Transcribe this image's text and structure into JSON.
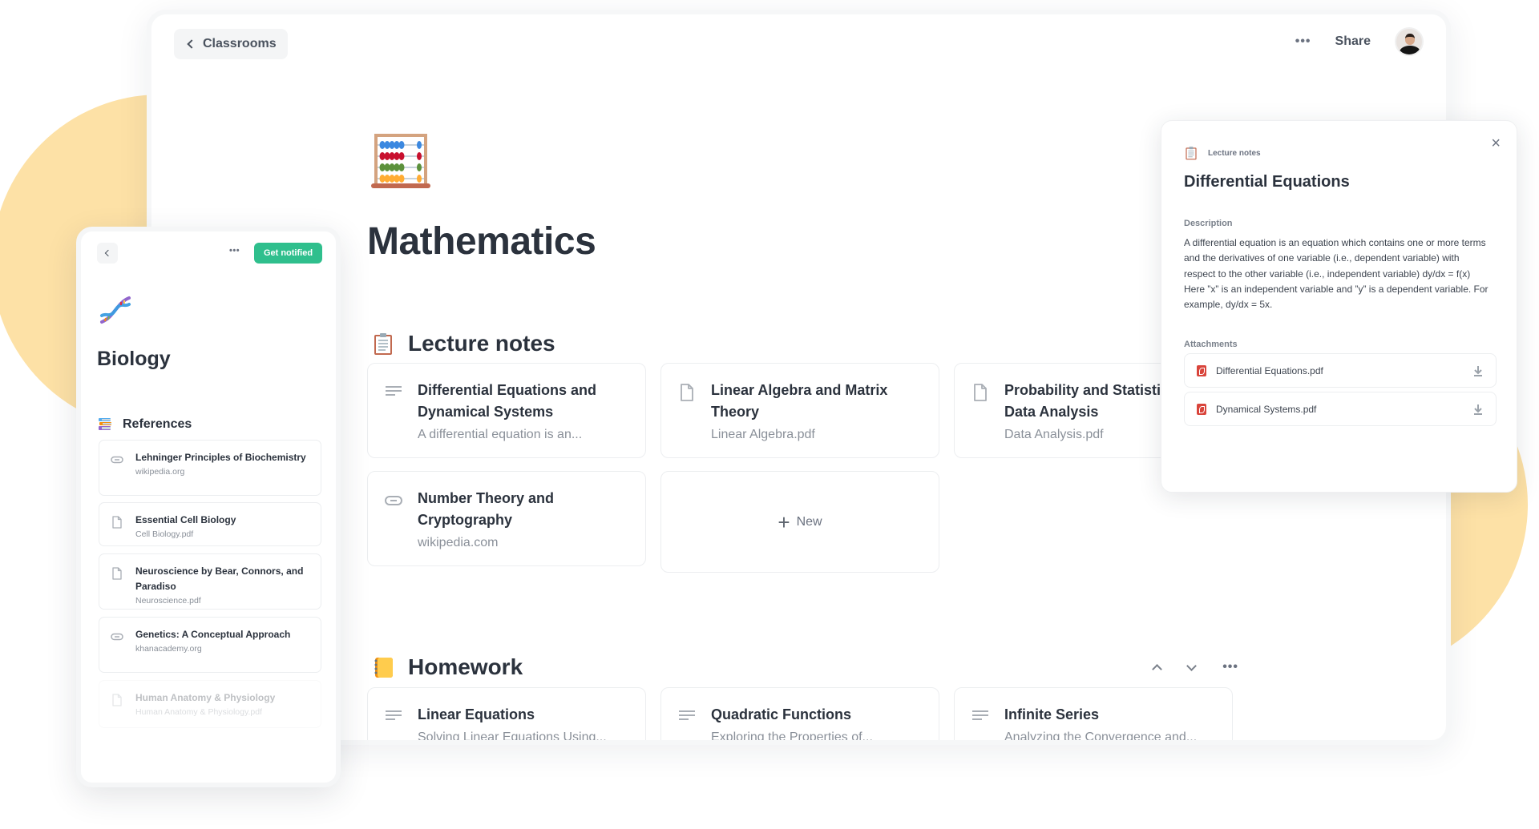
{
  "topbar": {
    "back_label": "Classrooms",
    "more_label": "•••",
    "share_label": "Share"
  },
  "page": {
    "icon": "abacus-icon",
    "title": "Mathematics"
  },
  "sections": [
    {
      "title": "Lecture notes",
      "icon": "clipboard-icon",
      "cards": [
        {
          "icon": "text-lines-icon",
          "title": "Differential Equations and Dynamical Systems",
          "subtitle": "A differential equation is an..."
        },
        {
          "icon": "file-icon",
          "title": "Linear Algebra and Matrix Theory",
          "subtitle": "Linear Algebra.pdf"
        },
        {
          "icon": "file-icon",
          "title": "Probability and Statistics for Data Analysis",
          "title_visible": "Probability and Statisti",
          "title_line2": "Data Analysis",
          "subtitle": "Data Analysis.pdf"
        },
        {
          "icon": "link-icon",
          "title": "Number Theory and Cryptography",
          "subtitle": "wikipedia.com"
        }
      ],
      "new_label": "New"
    },
    {
      "title": "Homework",
      "icon": "notebook-icon",
      "cards": [
        {
          "icon": "text-lines-icon",
          "title": "Linear Equations",
          "subtitle": "Solving Linear Equations Using..."
        },
        {
          "icon": "text-lines-icon",
          "title": "Quadratic Functions",
          "subtitle": "Exploring the Properties of..."
        },
        {
          "icon": "text-lines-icon",
          "title": "Infinite Series",
          "subtitle": "Analyzing the Convergence and..."
        }
      ],
      "more_label": "•••"
    }
  ],
  "detail": {
    "breadcrumb": "Lecture notes",
    "title": "Differential Equations",
    "description_label": "Description",
    "description": "A differential equation is an equation which contains one or more terms and the derivatives of one variable (i.e., dependent variable) with respect to the other variable (i.e., independent variable) dy/dx = f(x) Here ”x” is an independent variable and ”y” is a dependent variable. For example, dy/dx = 5x.",
    "attachments_label": "Attachments",
    "attachments": [
      {
        "name": "Differential Equations.pdf"
      },
      {
        "name": "Dynamical Systems.pdf"
      }
    ],
    "close_label": "×"
  },
  "biology": {
    "more_label": "•••",
    "notify_label": "Get notified",
    "title": "Biology",
    "section_title": "References",
    "references": [
      {
        "icon": "link-icon",
        "title": "Lehninger Principles of Biochemistry",
        "subtitle": "wikipedia.org"
      },
      {
        "icon": "file-icon",
        "title": "Essential Cell Biology",
        "subtitle": "Cell Biology.pdf"
      },
      {
        "icon": "file-icon",
        "title": "Neuroscience by Bear, Connors, and Paradiso",
        "subtitle": "Neuroscience.pdf"
      },
      {
        "icon": "link-icon",
        "title": "Genetics: A Conceptual Approach",
        "subtitle": "khanacademy.org"
      },
      {
        "icon": "file-icon",
        "title": "Human Anatomy & Physiology",
        "subtitle": "Human Anatomy & Physiology.pdf"
      }
    ]
  },
  "colors": {
    "accent_green": "#2fbf8d",
    "blob_yellow": "#fde1a6",
    "pdf_red": "#d9443b",
    "text_dark": "#2b323d"
  }
}
